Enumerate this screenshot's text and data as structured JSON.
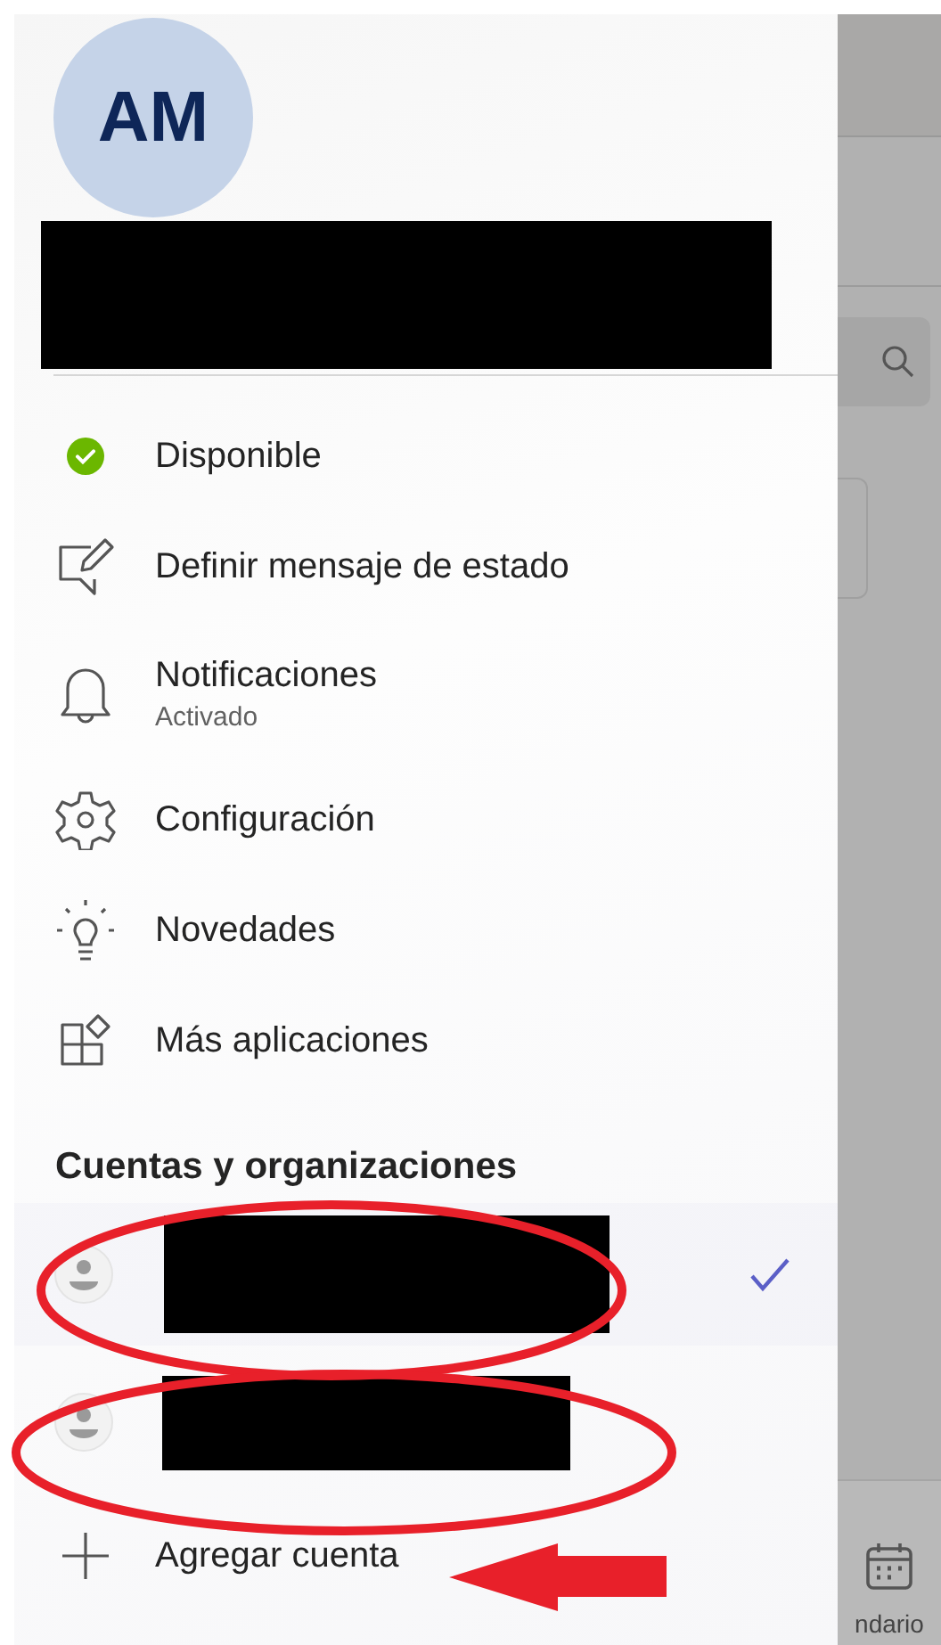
{
  "profile": {
    "initials": "AM"
  },
  "menu": [
    {
      "kind": "status",
      "label": "Disponible"
    },
    {
      "kind": "message",
      "label": "Definir mensaje de estado"
    },
    {
      "kind": "bell",
      "label": "Notificaciones",
      "sublabel": "Activado"
    },
    {
      "kind": "gear",
      "label": "Configuración"
    },
    {
      "kind": "bulb",
      "label": "Novedades"
    },
    {
      "kind": "apps",
      "label": "Más aplicaciones"
    }
  ],
  "accounts": {
    "heading": "Cuentas y organizaciones",
    "items": [
      {
        "selected": true
      },
      {
        "selected": false
      }
    ],
    "add_label": "Agregar cuenta"
  },
  "annotations": [
    {
      "kind": "ellipse"
    },
    {
      "kind": "ellipse"
    },
    {
      "kind": "arrow"
    }
  ],
  "background": {
    "tab_label": "ndario"
  }
}
